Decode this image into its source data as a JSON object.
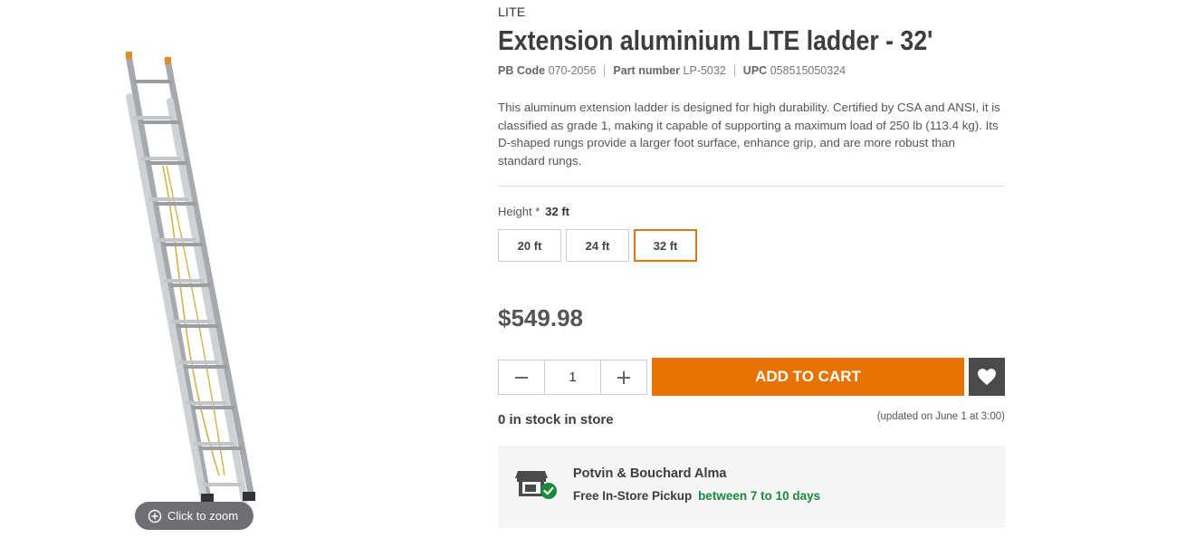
{
  "gallery": {
    "image_subject": "aluminium extension ladder",
    "zoom_label": "Click to zoom"
  },
  "product": {
    "brand": "LITE",
    "title": "Extension aluminium LITE ladder - 32'",
    "codes": [
      {
        "label": "PB Code",
        "value": "070-2056"
      },
      {
        "label": "Part number",
        "value": "LP-5032"
      },
      {
        "label": "UPC",
        "value": "058515050324"
      }
    ],
    "description": "This aluminum extension ladder is designed for high durability. Certified by CSA and ANSI, it is classified as grade 1, making it capable of supporting a maximum load of 250 lb (113.4 kg). Its D-shaped rungs provide a larger foot surface, enhance grip, and are more robust than standard rungs."
  },
  "options": {
    "height_label": "Height *",
    "height_selected": "32 ft",
    "sizes": [
      "20 ft",
      "24 ft",
      "32 ft"
    ]
  },
  "purchase": {
    "price": "$549.98",
    "quantity": "1",
    "add_to_cart": "ADD TO CART"
  },
  "stock": {
    "status": "0 in stock in store",
    "updated": "(updated on June 1 at 3:00)"
  },
  "pickup": {
    "store": "Potvin & Bouchard Alma",
    "method": "Free In-Store Pickup",
    "delay": "between 7 to 10 days"
  },
  "colors": {
    "accent": "#e77200",
    "success": "#1a8a3c",
    "wishlist_bg": "#4a4a4a"
  },
  "icons": {
    "zoom": "zoom-in-icon",
    "minus": "minus-icon",
    "plus": "plus-icon",
    "wishlist": "heart-icon",
    "store": "store-icon",
    "check": "check-badge-icon"
  }
}
